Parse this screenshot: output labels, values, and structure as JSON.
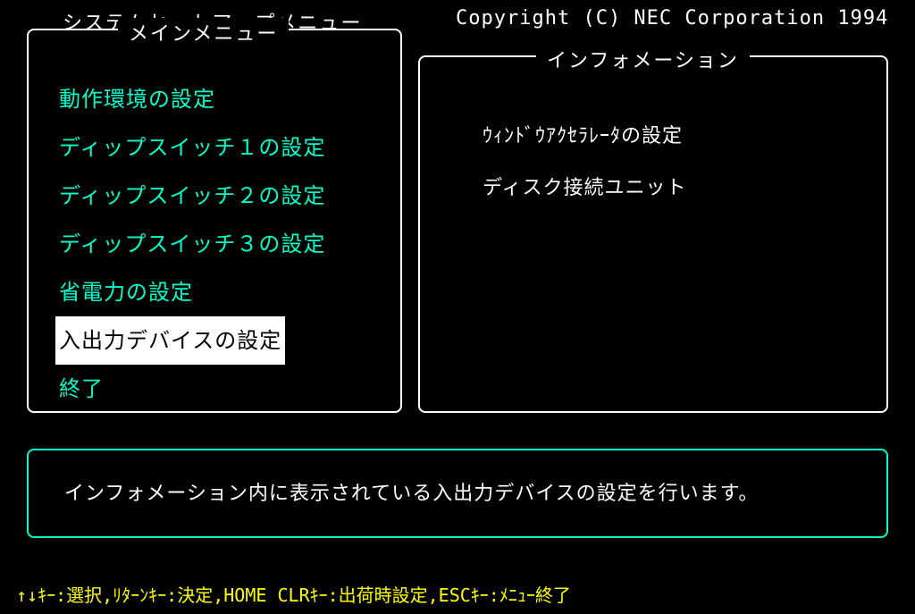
{
  "header": {
    "title": "システムセットアップメニュー",
    "copyright": "Copyright (C) NEC Corporation 1994"
  },
  "mainMenu": {
    "title": "メインメニュー",
    "items": [
      {
        "label": "動作環境の設定",
        "selected": false
      },
      {
        "label": "ディップスイッチ１の設定",
        "selected": false
      },
      {
        "label": "ディップスイッチ２の設定",
        "selected": false
      },
      {
        "label": "ディップスイッチ３の設定",
        "selected": false
      },
      {
        "label": "省電力の設定",
        "selected": false
      },
      {
        "label": "入出力デバイスの設定",
        "selected": true
      },
      {
        "label": "終了",
        "selected": false
      }
    ]
  },
  "infoPanel": {
    "title": "インフォメーション",
    "items": [
      "ｳｨﾝﾄﾞｳｱｸｾﾗﾚｰﾀの設定",
      "ディスク接続ユニット"
    ]
  },
  "description": "インフォメーション内に表示されている入出力デバイスの設定を行います。",
  "footer": "↑↓ｷｰ:選択,ﾘﾀｰﾝｷｰ:決定,HOME CLRｷｰ:出荷時設定,ESCｷｰ:ﾒﾆｭｰ終了"
}
